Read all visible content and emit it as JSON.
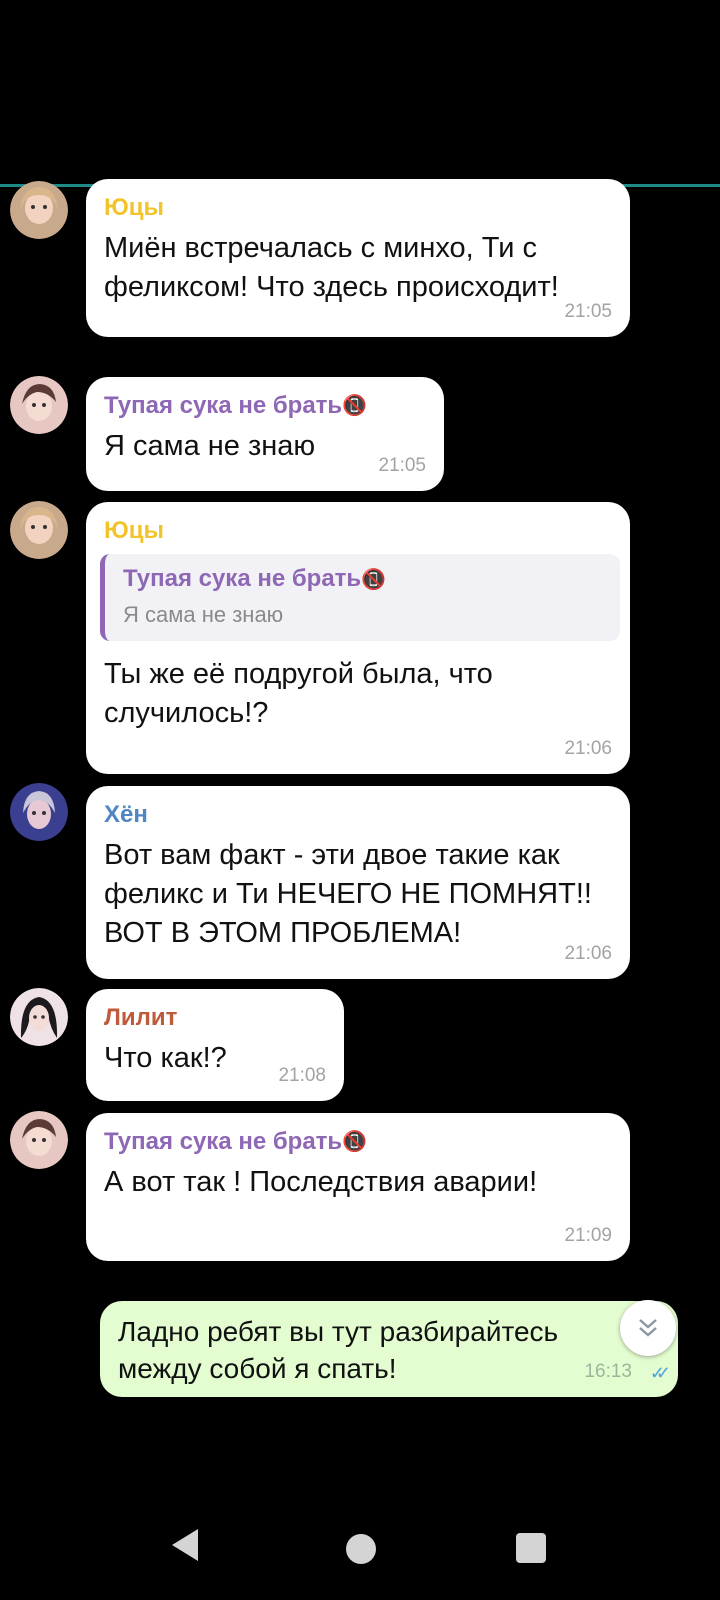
{
  "theme": {
    "accent_line": "#1e8a85",
    "color_yutsy": "#f2c42b",
    "color_tupaya": "#8e67b5",
    "color_hyon": "#4e86c5",
    "color_lilit": "#bf5a3b"
  },
  "messages": [
    {
      "sender": "Юцы",
      "text": "Миён встречалась с минхо, Ти с феликсом! Что здесь происходит!",
      "time": "21:05"
    },
    {
      "sender": "Тупая сука не брать",
      "sender_emoji": "📵",
      "text": "Я сама не знаю",
      "time": "21:05"
    },
    {
      "sender": "Юцы",
      "reply_sender": "Тупая сука не брать",
      "reply_emoji": "📵",
      "reply_text": "Я сама не знаю",
      "text": "Ты же её подругой была, что случилось!?",
      "time": "21:06"
    },
    {
      "sender": "Хён",
      "text": "Вот вам факт - эти двое такие как феликс и Ти НЕЧЕГО НЕ ПОМНЯТ!! ВОТ В ЭТОМ ПРОБЛЕМА!",
      "time": "21:06"
    },
    {
      "sender": "Лилит",
      "text": "Что как!?",
      "time": "21:08"
    },
    {
      "sender": "Тупая сука не брать",
      "sender_emoji": "📵",
      "text": "А вот так ! Последствия аварии!",
      "time": "21:09"
    },
    {
      "text": "Ладно ребят вы тут разбирайтесь между собой я спать!",
      "time": "16:13"
    }
  ],
  "icons": {
    "scroll_down": "chevron-double-down-icon",
    "read_receipt": "double-check-icon",
    "nav_back": "triangle-back-icon",
    "nav_home": "circle-home-icon",
    "nav_recent": "square-recents-icon"
  }
}
